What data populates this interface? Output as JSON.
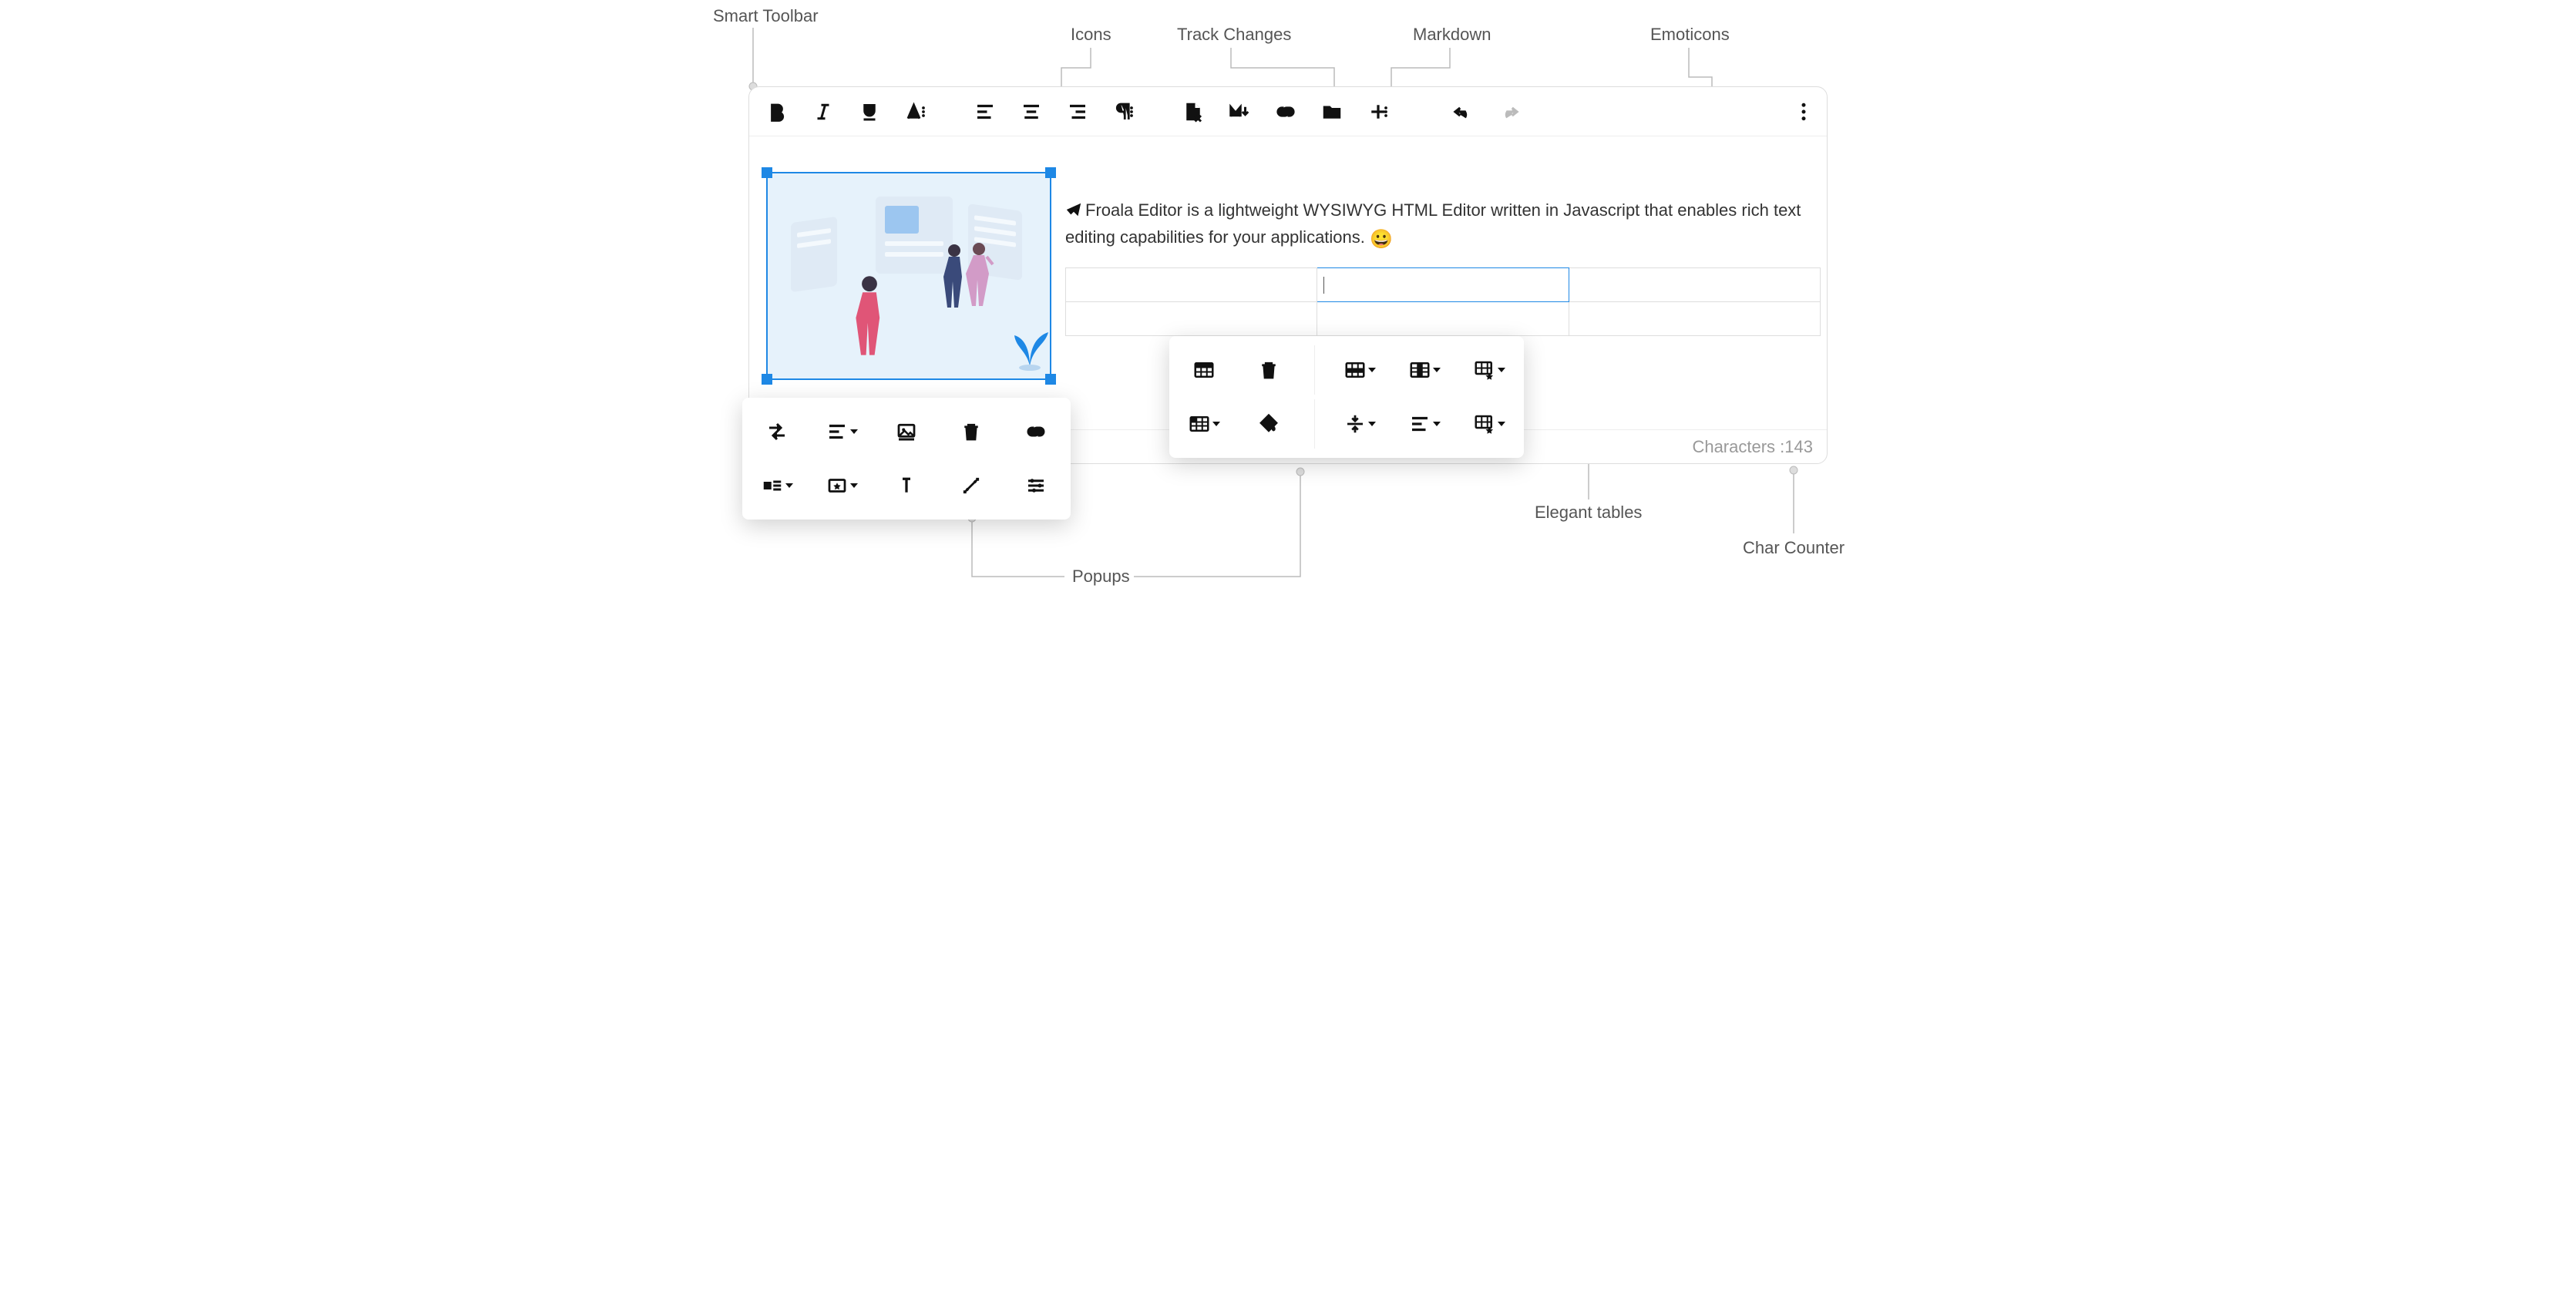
{
  "annotations": {
    "smart_toolbar": "Smart Toolbar",
    "icons": "Icons",
    "track_changes": "Track Changes",
    "markdown": "Markdown",
    "emoticons": "Emoticons",
    "popups": "Popups",
    "elegant_tables": "Elegant tables",
    "char_counter": "Char Counter"
  },
  "editor": {
    "content_text": "Froala Editor is a lightweight WYSIWYG HTML Editor written in Javascript that enables rich text editing capabilities for your applications.",
    "emoji": "😀",
    "char_counter_label": "Characters : ",
    "char_counter_value": "143"
  }
}
